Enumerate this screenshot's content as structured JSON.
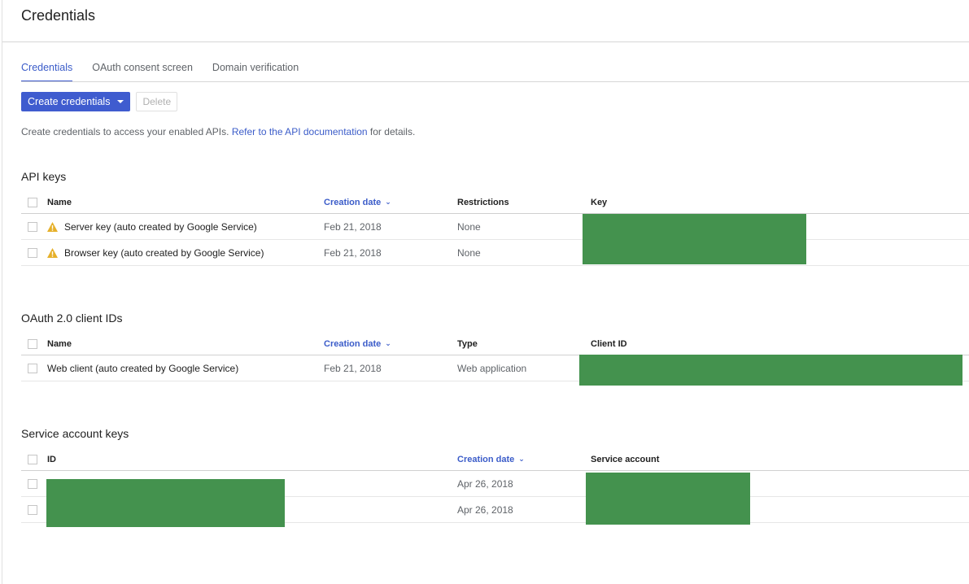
{
  "page": {
    "title": "Credentials"
  },
  "tabs": [
    {
      "label": "Credentials",
      "active": true
    },
    {
      "label": "OAuth consent screen",
      "active": false
    },
    {
      "label": "Domain verification",
      "active": false
    }
  ],
  "toolbar": {
    "create_label": "Create credentials",
    "delete_label": "Delete"
  },
  "intro": {
    "text_before": "Create credentials to access your enabled APIs. ",
    "link_text": "Refer to the API documentation",
    "text_after": " for details."
  },
  "colors": {
    "accent": "#3f5ccf",
    "warning": "#e6b02a",
    "redaction": "#44924e"
  },
  "api_keys": {
    "title": "API keys",
    "columns": {
      "name": "Name",
      "date": "Creation date",
      "restrictions": "Restrictions",
      "key": "Key"
    },
    "rows": [
      {
        "icon": "warning-icon",
        "name": "Server key (auto created by Google Service)",
        "date": "Feb 21, 2018",
        "restrictions": "None",
        "key": "[redacted]"
      },
      {
        "icon": "warning-icon",
        "name": "Browser key (auto created by Google Service)",
        "date": "Feb 21, 2018",
        "restrictions": "None",
        "key": "[redacted]"
      }
    ]
  },
  "oauth": {
    "title": "OAuth 2.0 client IDs",
    "columns": {
      "name": "Name",
      "date": "Creation date",
      "type": "Type",
      "client_id": "Client ID"
    },
    "rows": [
      {
        "name": "Web client (auto created by Google Service)",
        "date": "Feb 21, 2018",
        "type": "Web application",
        "client_id": "[redacted]"
      }
    ]
  },
  "service_keys": {
    "title": "Service account keys",
    "columns": {
      "id": "ID",
      "date": "Creation date",
      "account": "Service account"
    },
    "rows": [
      {
        "id": "[redacted]",
        "date": "Apr 26, 2018",
        "account": "[redacted]"
      },
      {
        "id": "[redacted]",
        "date": "Apr 26, 2018",
        "account": "[redacted]"
      }
    ]
  }
}
